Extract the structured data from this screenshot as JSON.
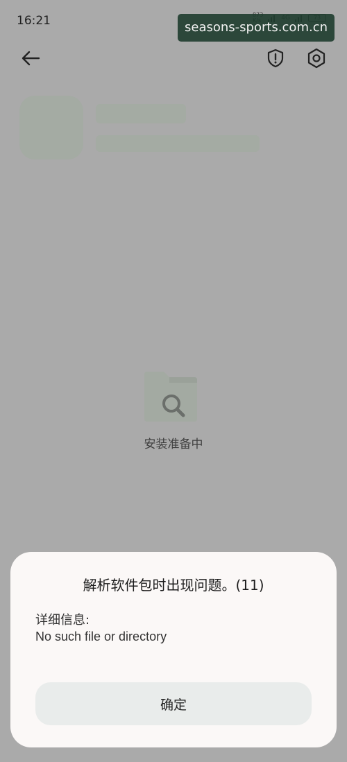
{
  "status_bar": {
    "time": "16:21",
    "net_speed": "873\nK/s",
    "network": "4G",
    "battery": "73"
  },
  "watermark": "seasons-sports.com.cn",
  "toolbar": {
    "back_icon": "arrow-left-icon",
    "security_icon": "shield-alert-icon",
    "settings_icon": "gear-icon"
  },
  "main": {
    "status_label": "安装准备中"
  },
  "dialog": {
    "title": "解析软件包时出现问题。(11)",
    "detail_label": "详细信息:",
    "detail_text": "No such file or directory",
    "confirm_label": "确定"
  }
}
